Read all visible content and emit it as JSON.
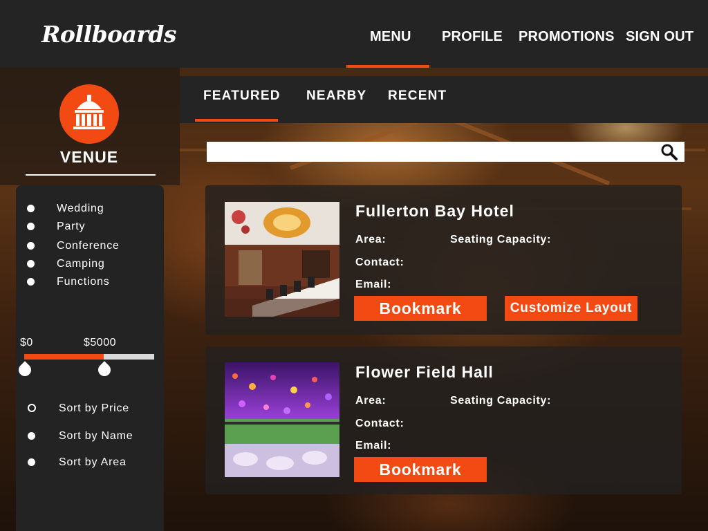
{
  "app": {
    "logo": "Rollboards",
    "accent_color": "#f24a12"
  },
  "nav": {
    "items": [
      {
        "label": "MENU",
        "active": true
      },
      {
        "label": "PROFILE",
        "active": false
      },
      {
        "label": "PROMOTIONS",
        "active": false
      },
      {
        "label": "SIGN OUT",
        "active": false
      }
    ]
  },
  "sidebar": {
    "venue_label": "VENUE",
    "venue_icon": "building-icon",
    "categories": [
      "Wedding",
      "Party",
      "Conference",
      "Camping",
      "Functions"
    ],
    "price": {
      "min_label": "$0",
      "max_label": "$5000",
      "range_fill": 0.61
    },
    "sort_options": [
      {
        "label": "Sort by Price",
        "selected": false
      },
      {
        "label": "Sort by Name",
        "selected": true
      },
      {
        "label": "Sort by Area",
        "selected": true
      }
    ]
  },
  "tabs": {
    "items": [
      {
        "label": "FEATURED",
        "active": true
      },
      {
        "label": "NEARBY",
        "active": false
      },
      {
        "label": "RECENT",
        "active": false
      }
    ]
  },
  "search": {
    "value": "",
    "placeholder": "",
    "icon": "search-icon"
  },
  "venues": [
    {
      "name": "Fullerton Bay Hotel",
      "area_label": "Area:",
      "seating_label": "Seating Capacity:",
      "contact_label": "Contact:",
      "email_label": "Email:",
      "bookmark_label": "Bookmark",
      "customize_label": "Customize Layout"
    },
    {
      "name": "Flower Field Hall",
      "area_label": "Area:",
      "seating_label": "Seating Capacity:",
      "contact_label": "Contact:",
      "email_label": "Email:",
      "bookmark_label": "Bookmark"
    }
  ]
}
